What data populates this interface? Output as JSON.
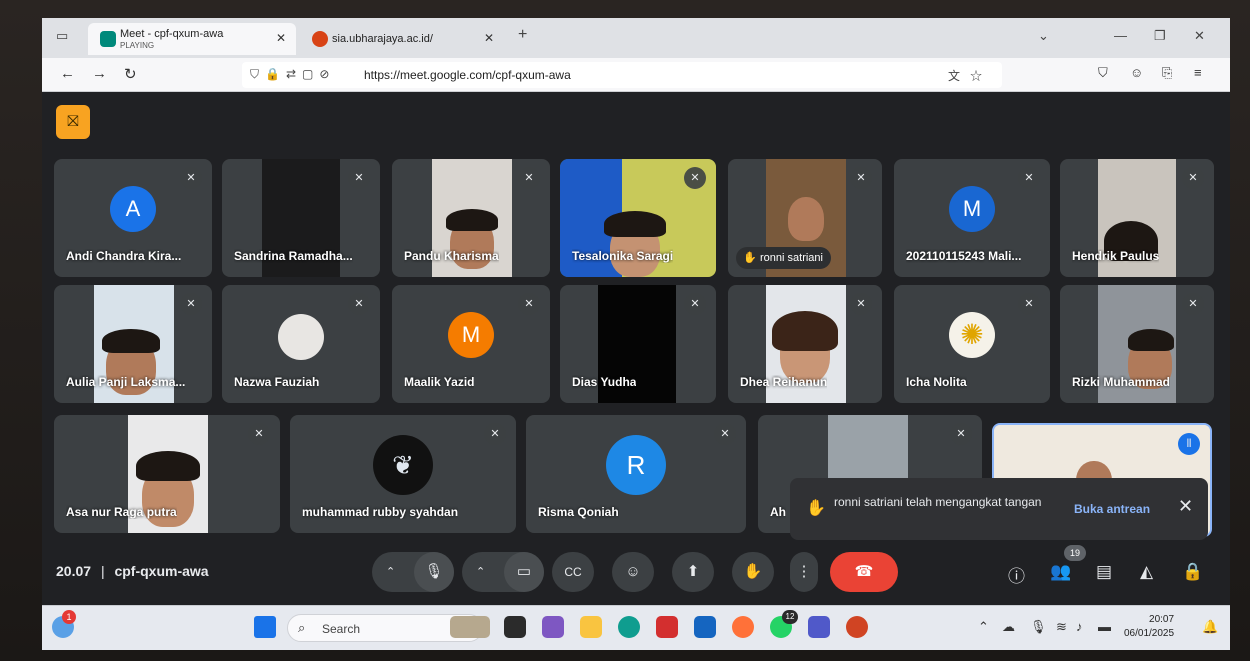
{
  "browser": {
    "tabs": [
      {
        "title": "Meet - cpf-qxum-awa",
        "subtitle": "PLAYING",
        "close": "✕"
      },
      {
        "title": "sia.ubharajaya.ac.id/",
        "close": "✕"
      }
    ],
    "new_tab": "+",
    "url": "https://meet.google.com/cpf-qxum-awa"
  },
  "meet": {
    "participants_row1": [
      {
        "name": "Andi Chandra Kira...",
        "avatar_letter": "A",
        "avatar_color": "#1a73e8"
      },
      {
        "name": "Sandrina Ramadha..."
      },
      {
        "name": "Pandu Kharisma"
      },
      {
        "name": "Tesalonika Saragi"
      },
      {
        "name": "ronni satriani"
      },
      {
        "name": "202110115243 Mali...",
        "avatar_letter": "M",
        "avatar_color": "#1967d2"
      },
      {
        "name": "Hendrik Paulus"
      }
    ],
    "participants_row2": [
      {
        "name": "Aulia Panji Laksma..."
      },
      {
        "name": "Nazwa Fauziah"
      },
      {
        "name": "Maalik Yazid",
        "avatar_letter": "M",
        "avatar_color": "#f57c00"
      },
      {
        "name": "Dias Yudha"
      },
      {
        "name": "Dhea Reihanun"
      },
      {
        "name": "Icha Nolita"
      },
      {
        "name": "Rizki Muhammad"
      }
    ],
    "participants_row3": [
      {
        "name": "Asa nur Raga putra"
      },
      {
        "name": "muhammad rubby syahdan"
      },
      {
        "name": "Risma Qoniah",
        "avatar_letter": "R",
        "avatar_color": "#1e88e5"
      },
      {
        "name": "Ah"
      }
    ],
    "notification": {
      "message": "ronni satriani telah mengangkat tangan",
      "action": "Buka antrean",
      "close": "✕"
    },
    "time": "20.07",
    "separator": "|",
    "meeting_code": "cpf-qxum-awa",
    "participant_count": "19"
  },
  "taskbar": {
    "search_placeholder": "Search",
    "notification_count": "1",
    "whatsapp_badge": "12",
    "clock_time": "20:07",
    "clock_date": "06/01/2025"
  },
  "colors": {
    "meet_bg": "#202124",
    "tile_bg": "#3c4043",
    "end_call": "#ea4335",
    "link": "#8ab4f8"
  }
}
